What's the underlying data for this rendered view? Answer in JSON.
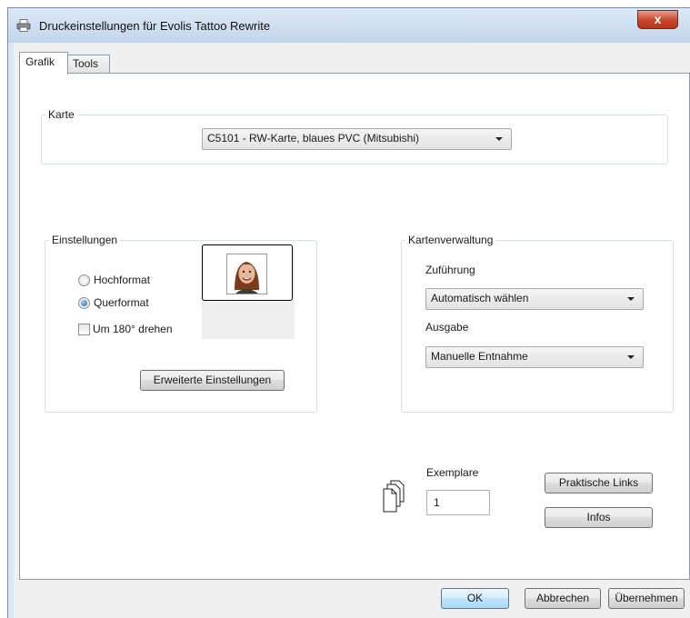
{
  "window": {
    "title": "Druckeinstellungen für Evolis Tattoo Rewrite",
    "icon": "printer-icon",
    "close_glyph": "x"
  },
  "tabs": [
    {
      "label": "Grafik",
      "active": true
    },
    {
      "label": "Tools",
      "active": false
    }
  ],
  "karte": {
    "group_label": "Karte",
    "selected": "C5101 - RW-Karte, blaues PVC (Mitsubishi)"
  },
  "einstellungen": {
    "group_label": "Einstellungen",
    "orientation_options": [
      {
        "label": "Hochformat",
        "selected": false
      },
      {
        "label": "Querformat",
        "selected": true
      }
    ],
    "rotate_label": "Um 180° drehen",
    "rotate_checked": false,
    "advanced_button": "Erweiterte Einstellungen"
  },
  "kartenverwaltung": {
    "group_label": "Kartenverwaltung",
    "feed_label": "Zuführung",
    "feed_value": "Automatisch wählen",
    "output_label": "Ausgabe",
    "output_value": "Manuelle Entnahme"
  },
  "copies": {
    "label": "Exemplare",
    "value": "1",
    "icon": "copies-icon"
  },
  "side_buttons": {
    "links": "Praktische Links",
    "info": "Infos"
  },
  "footer": {
    "ok": "OK",
    "cancel": "Abbrechen",
    "apply": "Übernehmen"
  }
}
